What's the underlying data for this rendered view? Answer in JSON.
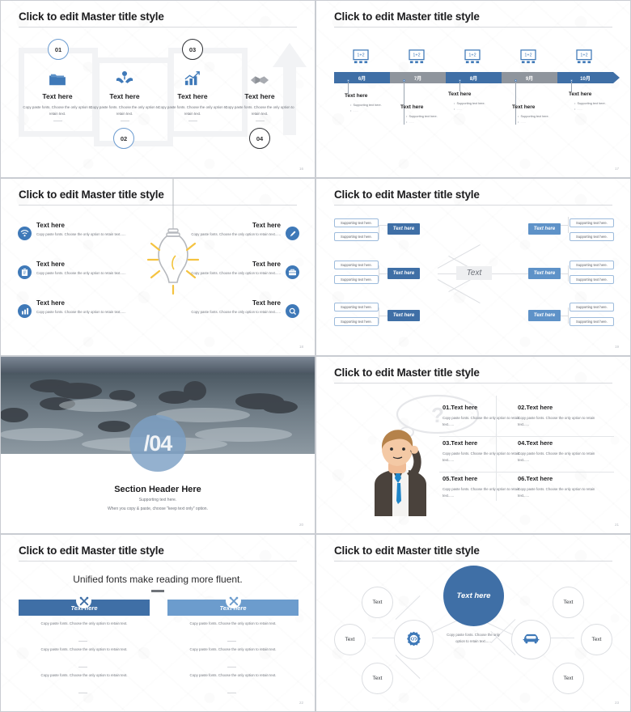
{
  "common": {
    "master_title": "Click to edit Master title style",
    "body_text": "Copy paste fonts. Choose the only option to retain text.",
    "text_here": "Text here",
    "supporting": "Supporting text here.",
    "accent_dark": "#3f6fa6",
    "accent_light": "#5e92c8",
    "gray_seg": "#8f959d"
  },
  "slide1": {
    "title": "Click to edit Master title style",
    "page": "16",
    "badges": [
      "01",
      "02",
      "03",
      "04"
    ],
    "columns": [
      {
        "icon": "folder-icon",
        "heading": "Text here",
        "body": "Copy paste fonts. Choose the only option to retain text."
      },
      {
        "icon": "care-hands-icon",
        "heading": "Text here",
        "body": "Copy paste fonts. Choose the only option to retain text."
      },
      {
        "icon": "bar-chart-growth-icon",
        "heading": "Text here",
        "body": "Copy paste fonts. Choose the only option to retain text."
      },
      {
        "icon": "handshake-icon",
        "heading": "Text here",
        "body": "Copy paste fonts. Choose the only option to retain text."
      }
    ]
  },
  "slide2": {
    "title": "Click to edit Master title style",
    "page": "17",
    "icon_label": "1+2",
    "icon_name": "presentation-board-icon",
    "segments": [
      {
        "label": "6月",
        "color": "#3f6fa6"
      },
      {
        "label": "7月",
        "color": "#8f959d"
      },
      {
        "label": "8月",
        "color": "#3f6fa6"
      },
      {
        "label": "9月",
        "color": "#8f959d"
      },
      {
        "label": "10月",
        "color": "#3f6fa6"
      }
    ],
    "items": [
      {
        "heading": "Text here",
        "bullet": "Supporting text here."
      },
      {
        "heading": "Text here",
        "bullet": "Supporting text here."
      },
      {
        "heading": "Text here",
        "bullet": "Supporting text here."
      },
      {
        "heading": "Text here",
        "bullet": "Supporting text here."
      },
      {
        "heading": "Text here",
        "bullet": "Supporting text here."
      }
    ]
  },
  "slide3": {
    "title": "Click to edit Master title style",
    "page": "18",
    "center_icon": "lightbulb-icon",
    "left_items": [
      {
        "icon": "wifi-icon",
        "heading": "Text here",
        "body": "Copy paste fonts. Choose the only option to retain text......"
      },
      {
        "icon": "clipboard-icon",
        "heading": "Text here",
        "body": "Copy paste fonts. Choose the only option to retain text......"
      },
      {
        "icon": "bar-chart-icon",
        "heading": "Text here",
        "body": "Copy paste fonts. Choose the only option to retain text......"
      }
    ],
    "right_items": [
      {
        "icon": "pencil-icon",
        "heading": "Text here",
        "body": "Copy paste fonts. Choose the only option to retain text......"
      },
      {
        "icon": "briefcase-icon",
        "heading": "Text here",
        "body": "Copy paste fonts. Choose the only option to retain text......"
      },
      {
        "icon": "search-icon",
        "heading": "Text here",
        "body": "Copy paste fonts. Choose the only option to retain text......"
      }
    ]
  },
  "slide4": {
    "title": "Click to edit Master title style",
    "page": "19",
    "center": "Text",
    "node_label": "Text here",
    "leaf_label": "Supporting text here.",
    "left_nodes": [
      "Text here",
      "Text here",
      "Text here"
    ],
    "right_nodes": [
      "Text here",
      "Text here",
      "Text here"
    ]
  },
  "slide5": {
    "page": "20",
    "number": "/04",
    "heading": "Section Header Here",
    "sub1": "Supporting text here.",
    "sub2": "When you copy & paste, choose \"keep text only\" option.",
    "photo_alt": "rocky-seascape-photo"
  },
  "slide6": {
    "title": "Click to edit Master title style",
    "page": "21",
    "illustration": "businessman-thinking-illustration",
    "bubble": "?",
    "cells": [
      {
        "heading": "01.Text here",
        "body": "Copy paste fonts. Choose the only option to retain text......"
      },
      {
        "heading": "02.Text here",
        "body": "Copy paste fonts. Choose the only option to retain text......"
      },
      {
        "heading": "03.Text here",
        "body": "Copy paste fonts. Choose the only option to retain text......"
      },
      {
        "heading": "04.Text here",
        "body": "Copy paste fonts. Choose the only option to retain text......"
      },
      {
        "heading": "05.Text here",
        "body": "Copy paste fonts. Choose the only option to retain text......"
      },
      {
        "heading": "06.Text here",
        "body": "Copy paste fonts. Choose the only option to retain text......"
      }
    ]
  },
  "slide7": {
    "title": "Click to edit Master title style",
    "page": "22",
    "subtitle": "Unified fonts make reading more fluent.",
    "left": {
      "header": "Text here",
      "icon": "tools-cross-icon",
      "color": "#3f6fa6",
      "paras": [
        "Copy paste fonts. Choose the only option to retain text.",
        "Copy paste fonts. Choose the only option to retain text.",
        "Copy paste fonts. Choose the only option to retain text."
      ]
    },
    "right": {
      "header": "Text here",
      "icon": "tools-cross-icon",
      "color": "#6c9ccd",
      "paras": [
        "Copy paste fonts. Choose the only option to retain text.",
        "Copy paste fonts. Choose the only option to retain text.",
        "Copy paste fonts. Choose the only option to retain text."
      ]
    }
  },
  "slide8": {
    "title": "Click to edit Master title style",
    "page": "23",
    "center": "Text here",
    "body": "Copy paste fonts. Choose the only option to retain text......",
    "left_hub_icon": "gear-code-icon",
    "right_hub_icon": "car-icon",
    "left_nodes": [
      "Text",
      "Text",
      "Text"
    ],
    "right_nodes": [
      "Text",
      "Text",
      "Text"
    ]
  }
}
